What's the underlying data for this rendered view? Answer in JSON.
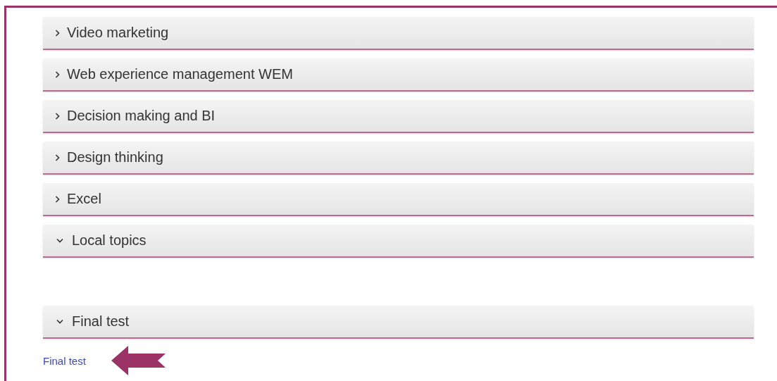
{
  "sections": [
    {
      "title": "Video marketing",
      "expanded": false
    },
    {
      "title": "Web experience management WEM",
      "expanded": false
    },
    {
      "title": "Decision making and BI",
      "expanded": false
    },
    {
      "title": "Design thinking",
      "expanded": false
    },
    {
      "title": "Excel",
      "expanded": false
    },
    {
      "title": "Local topics",
      "expanded": true
    },
    {
      "title": "Final test",
      "expanded": true,
      "link": "Final test"
    }
  ]
}
